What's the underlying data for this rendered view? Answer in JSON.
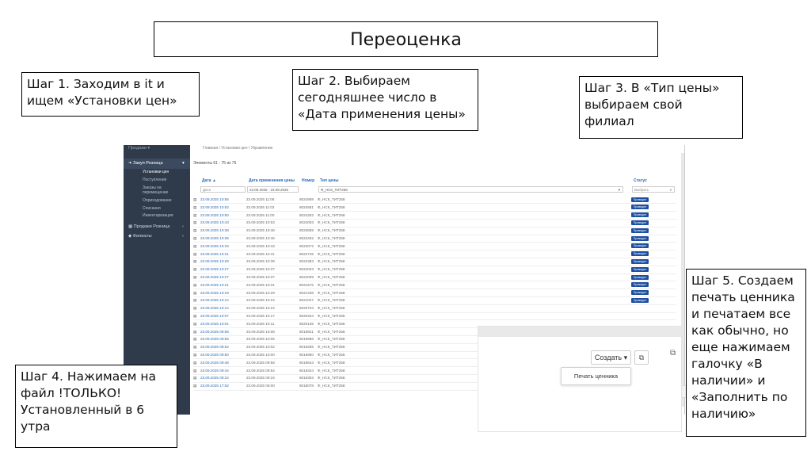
{
  "slide": {
    "title": "Переоценка",
    "step1": "Шаг 1. Заходим в it и\nищем «Установки цен»",
    "step2": "Шаг 2. Выбираем\nсегодняшнее число в\n«Дата применения цены»",
    "step3": "Шаг 3. В «Тип цены»\nвыбираем свой\nфилиал",
    "step4": "Шаг 4. Нажимаем на\nфайл !ТОЛЬКО!\nУстановленный в 6\nутра",
    "step5": "Шаг 5. Создаем\nпечать ценника\nи печатаем все\nкак обычно, но\nеще нажимаем\nгалочку «В\nналичии» и\n«Заполнить по\nналичию»"
  },
  "app": {
    "sidebar": {
      "top_item": "Продажи ▾",
      "section": "Закуп Розница",
      "subitems": [
        "Установки цен",
        "Поступления",
        "Заказы на",
        "перемещение",
        "Оприходование",
        "Списания",
        "Инвентаризация"
      ],
      "sales": "Продажи Розница",
      "branches": "Филиалы"
    },
    "breadcrumb": "Главная  /  Установки цен  /  Управление",
    "count_label": "Элементы 61 - 75 из 75",
    "columns": {
      "date": "Дата ▲",
      "apply_date": "Дата применения цены",
      "number": "Номер",
      "price_type": "Тип цены",
      "status": "Статус"
    },
    "filters": {
      "date_placeholder": "Дата",
      "apply_range": "23.09.2025 - 23.09.2025",
      "price_type": "Ф_НСК_ТИТ258",
      "status_select": "Выбрать"
    },
    "rows": [
      {
        "date": "23.09.2025 10:56",
        "apply": "23.09.2025 11:06",
        "num": "8024908",
        "type": "Ф_НСК_ТИТ258",
        "status": "Проведен"
      },
      {
        "date": "23.09.2025 10:52",
        "apply": "23.09.2025 11:02",
        "num": "8024581",
        "type": "Ф_НСК_ТИТ258",
        "status": "Проведен"
      },
      {
        "date": "23.09.2025 10:50",
        "apply": "23.09.2025 11:00",
        "num": "8024302",
        "type": "Ф_НСК_ТИТ258",
        "status": "Проведен"
      },
      {
        "date": "23.09.2025 10:43",
        "apply": "23.09.2025 10:53",
        "num": "8024003",
        "type": "Ф_НСК_ТИТ258",
        "status": "Проведен"
      },
      {
        "date": "23.09.2025 10:38",
        "apply": "23.09.2025 10:48",
        "num": "8023859",
        "type": "Ф_НСК_ТИТ258",
        "status": "Проведен"
      },
      {
        "date": "23.09.2025 10:36",
        "apply": "23.09.2025 10:46",
        "num": "8023402",
        "type": "Ф_НСК_ТИТ258",
        "status": "Проведен"
      },
      {
        "date": "23.09.2025 10:33",
        "apply": "23.09.2025 10:43",
        "num": "8023072",
        "type": "Ф_НСК_ТИТ258",
        "status": "Проведен"
      },
      {
        "date": "23.09.2025 10:31",
        "apply": "23.09.2025 10:41",
        "num": "8022745",
        "type": "Ф_НСК_ТИТ258",
        "status": "Проведен"
      },
      {
        "date": "23.09.2025 10:29",
        "apply": "23.09.2025 10:39",
        "num": "8022383",
        "type": "Ф_НСК_ТИТ258",
        "status": "Проведен"
      },
      {
        "date": "23.09.2025 10:27",
        "apply": "23.09.2025 10:37",
        "num": "8022023",
        "type": "Ф_НСК_ТИТ258",
        "status": "Проведен"
      },
      {
        "date": "23.09.2025 10:27",
        "apply": "23.09.2025 10:37",
        "num": "8022009",
        "type": "Ф_НСК_ТИТ258",
        "status": "Проведен"
      },
      {
        "date": "23.09.2025 10:21",
        "apply": "23.09.2025 10:31",
        "num": "8021576",
        "type": "Ф_НСК_ТИТ258",
        "status": "Проведен"
      },
      {
        "date": "23.09.2025 10:19",
        "apply": "23.09.2025 10:29",
        "num": "8021338",
        "type": "Ф_НСК_ТИТ258",
        "status": "Проведен"
      },
      {
        "date": "23.09.2025 10:14",
        "apply": "23.09.2025 10:24",
        "num": "8021027",
        "type": "Ф_НСК_ТИТ258",
        "status": "Проведен"
      },
      {
        "date": "23.09.2025 10:14",
        "apply": "23.09.2025 10:24",
        "num": "8020734",
        "type": "Ф_НСК_ТИТ258",
        "status": ""
      },
      {
        "date": "23.09.2025 10:07",
        "apply": "23.09.2025 10:17",
        "num": "8020434",
        "type": "Ф_НСК_ТИТ258",
        "status": ""
      },
      {
        "date": "23.09.2025 10:01",
        "apply": "23.09.2025 10:11",
        "num": "8020135",
        "type": "Ф_НСК_ТИТ258",
        "status": ""
      },
      {
        "date": "23.09.2025 09:58",
        "apply": "23.09.2025 10:08",
        "num": "8019821",
        "type": "Ф_НСК_ТИТ258",
        "status": ""
      },
      {
        "date": "23.09.2025 09:55",
        "apply": "23.09.2025 10:05",
        "num": "8019586",
        "type": "Ф_НСК_ТИТ258",
        "status": ""
      },
      {
        "date": "23.09.2025 09:52",
        "apply": "23.09.2025 10:02",
        "num": "8019255",
        "type": "Ф_НСК_ТИТ258",
        "status": ""
      },
      {
        "date": "23.09.2025 09:50",
        "apply": "23.09.2025 10:00",
        "num": "8018900",
        "type": "Ф_НСК_ТИТ258",
        "status": ""
      },
      {
        "date": "23.09.2025 09:48",
        "apply": "23.09.2025 09:58",
        "num": "8018643",
        "type": "Ф_НСК_ТИТ258",
        "status": ""
      },
      {
        "date": "23.09.2025 09:44",
        "apply": "23.09.2025 09:54",
        "num": "8018344",
        "type": "Ф_НСК_ТИТ258",
        "status": ""
      },
      {
        "date": "23.09.2025 09:24",
        "apply": "23.09.2025 09:34",
        "num": "8018303",
        "type": "Ф_НСК_ТИТ258",
        "status": ""
      },
      {
        "date": "23.09.2025 17:52",
        "apply": "23.09.2025 06:00",
        "num": "8018078",
        "type": "Ф_НСК_ТИТ258",
        "status": ""
      }
    ]
  },
  "overlay": {
    "create_label": "Создать ▾",
    "copy_glyph": "⧉",
    "print_label": "Печать ценника"
  }
}
